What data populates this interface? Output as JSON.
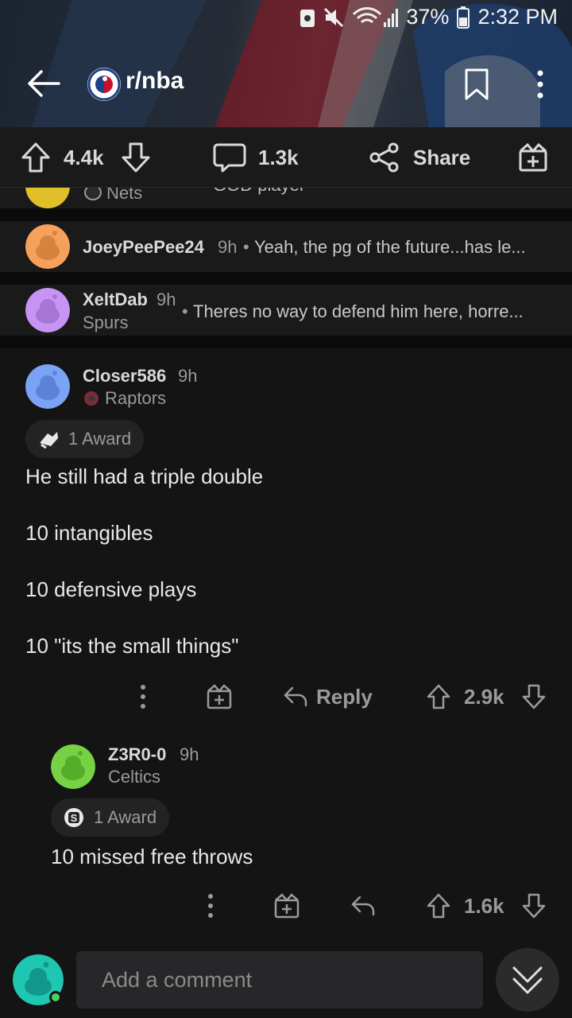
{
  "status": {
    "battery": "37%",
    "time": "2:32 PM"
  },
  "subreddit": {
    "name": "r/nba"
  },
  "post_actions": {
    "upvotes": "4.4k",
    "comments": "1.3k",
    "share": "Share"
  },
  "partial_comment": {
    "flair": "Nets",
    "text_fragment": "GOD player"
  },
  "collapsed": [
    {
      "user": "JoeyPeePee24",
      "age": "9h",
      "bullet": "•",
      "snippet": "Yeah, the pg of the future...has le...",
      "avatar_color": "#f6a15b"
    },
    {
      "user": "XeltDab",
      "age": "9h",
      "flair": "Spurs",
      "bullet": "•",
      "snippet": "Theres no way to defend him here, horre...",
      "avatar_color": "#c794f5"
    }
  ],
  "comment_main": {
    "user": "Closer586",
    "age": "9h",
    "flair": "Raptors",
    "award": "1 Award",
    "lines": [
      "He still had a triple double",
      "10 intangibles",
      "10 defensive plays",
      "10 \"its the small things\""
    ],
    "reply": "Reply",
    "score": "2.9k",
    "avatar_color": "#7aa3f5"
  },
  "comment_reply": {
    "user": "Z3R0-0",
    "age": "9h",
    "flair": "Celtics",
    "award": "1 Award",
    "text": "10 missed free throws",
    "score": "1.6k",
    "avatar_color": "#76d144"
  },
  "composer": {
    "placeholder": "Add a comment",
    "avatar_color": "#1fc7b2"
  },
  "icons": [
    "back-arrow-icon",
    "bookmark-icon",
    "more-icon",
    "upvote-icon",
    "downvote-icon",
    "comment-icon",
    "share-icon",
    "gift-icon",
    "reply-icon",
    "chevron-down-icon"
  ]
}
